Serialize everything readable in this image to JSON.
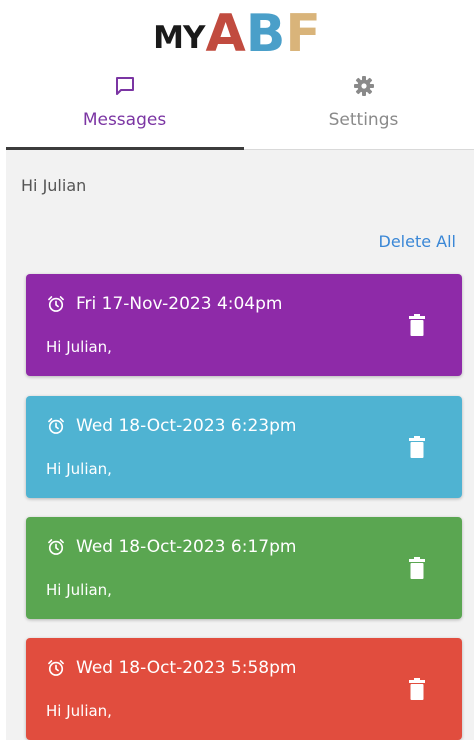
{
  "app": {
    "logo_my": "MY",
    "logo_letters": [
      "A",
      "B",
      "F"
    ],
    "logo_colors": [
      "#c14b3f",
      "#4a9fc9",
      "#d9b47a"
    ]
  },
  "tabs": [
    {
      "label": "Messages",
      "icon": "message-icon",
      "active": true,
      "color": "#7b35a3"
    },
    {
      "label": "Settings",
      "icon": "gear-icon",
      "active": false,
      "color": "#8a8a8a"
    }
  ],
  "main": {
    "greeting": "Hi Julian",
    "delete_all_label": "Delete All"
  },
  "messages": [
    {
      "time": "Fri 17-Nov-2023 4:04pm",
      "body": "Hi Julian,",
      "color": "#8e2aa8"
    },
    {
      "time": "Wed 18-Oct-2023 6:23pm",
      "body": "Hi Julian,",
      "color": "#4fb3d2"
    },
    {
      "time": "Wed 18-Oct-2023 6:17pm",
      "body": "Hi Julian,",
      "color": "#5aa651"
    },
    {
      "time": "Wed 18-Oct-2023 5:58pm",
      "body": "Hi Julian,",
      "color": "#e14d3e"
    }
  ],
  "icons": {
    "alarm": "alarm-clock-icon",
    "delete": "trash-icon"
  }
}
